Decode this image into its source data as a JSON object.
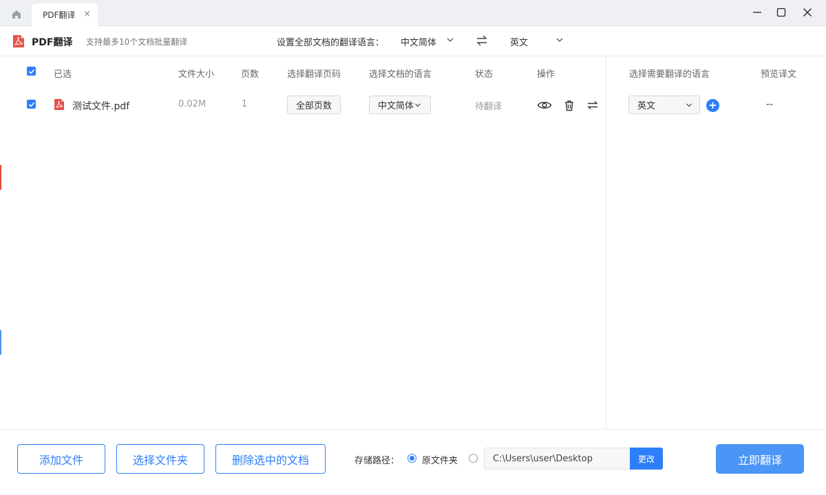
{
  "titlebar": {
    "tab_label": "PDF翻译",
    "tab_close": "×"
  },
  "header": {
    "app_name": "PDF翻译",
    "subtitle": "支持最多10个文档批量翻译",
    "lang_set_label": "设置全部文档的翻译语言：",
    "source_lang": "中文简体",
    "target_lang": "英文"
  },
  "table": {
    "columns": {
      "selected": "已选",
      "size": "文件大小",
      "pages": "页数",
      "page_range": "选择翻译页码",
      "doc_lang": "选择文档的语言",
      "status": "状态",
      "actions": "操作",
      "target_lang": "选择需要翻译的语言",
      "preview": "预览译文"
    },
    "rows": [
      {
        "file_name": "测试文件.pdf",
        "size": "0.02M",
        "pages": "1",
        "page_range": "全部页数",
        "doc_lang": "中文简体",
        "status": "待翻译",
        "target_lang": "英文",
        "add": "+",
        "preview": "--"
      }
    ]
  },
  "footer": {
    "add_file": "添加文件",
    "select_folder": "选择文件夹",
    "delete_selected": "删除选中的文档",
    "save_path_label": "存储路径：",
    "original_folder": "原文件夹",
    "custom_path": "C:\\Users\\user\\Desktop",
    "change": "更改",
    "translate_now": "立即翻译"
  },
  "colors": {
    "accent": "#2d7ff9",
    "primary_button": "#4b95f6",
    "pdf_red": "#e5534b"
  }
}
